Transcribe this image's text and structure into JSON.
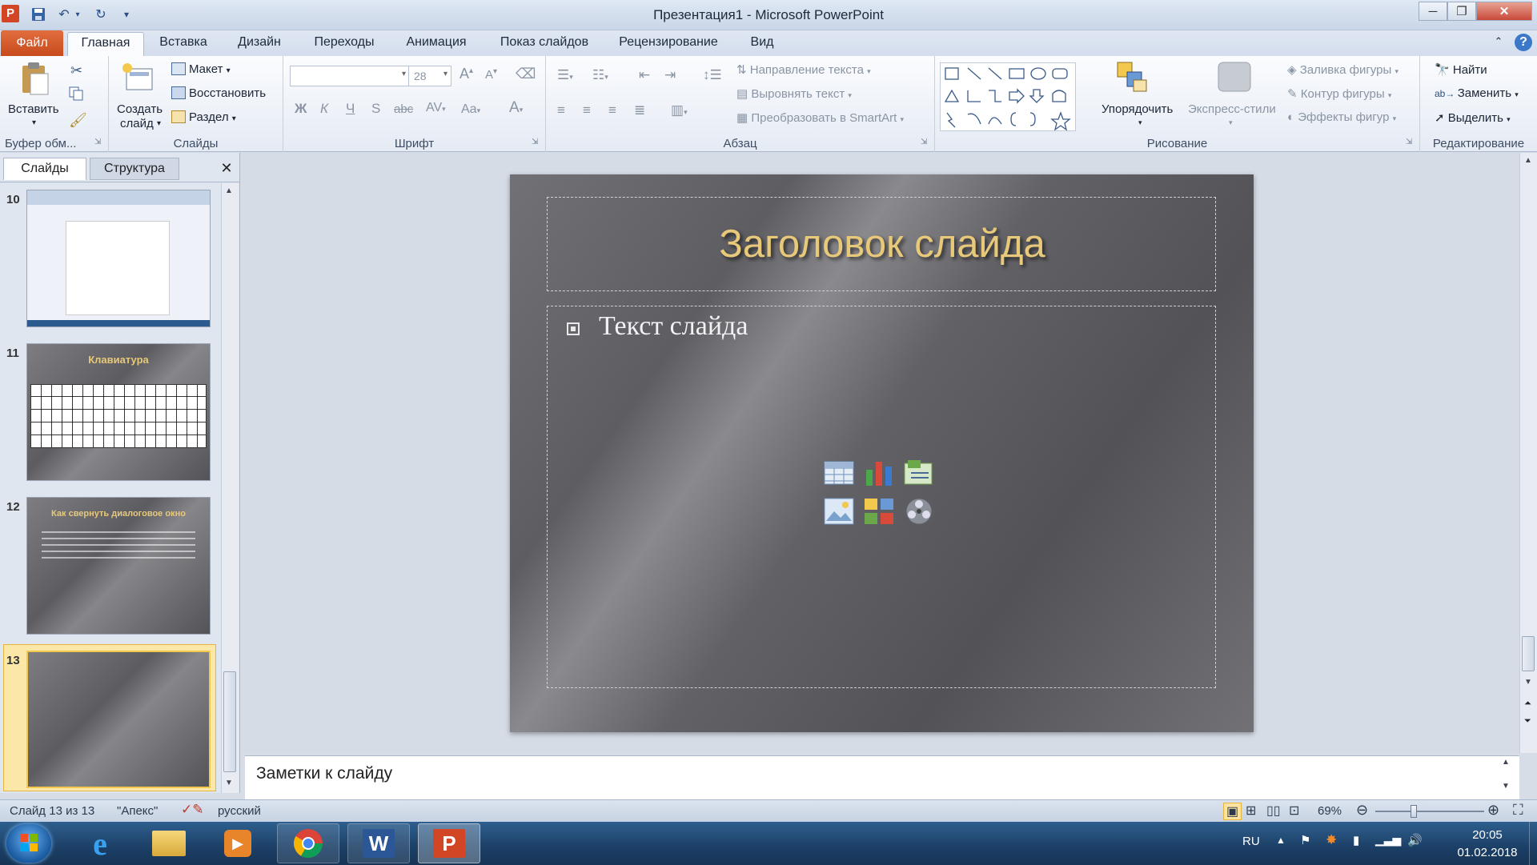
{
  "window": {
    "title": "Презентация1  -  Microsoft PowerPoint",
    "app_letter": "P"
  },
  "tabs": {
    "file": "Файл",
    "items": [
      "Главная",
      "Вставка",
      "Дизайн",
      "Переходы",
      "Анимация",
      "Показ слайдов",
      "Рецензирование",
      "Вид"
    ]
  },
  "ribbon": {
    "clipboard": {
      "label": "Буфер обм...",
      "paste": "Вставить"
    },
    "slides": {
      "label": "Слайды",
      "new_slide_1": "Создать",
      "new_slide_2": "слайд",
      "layout": "Макет",
      "reset": "Восстановить",
      "section": "Раздел"
    },
    "font": {
      "label": "Шрифт",
      "size": "28"
    },
    "paragraph": {
      "label": "Абзац",
      "text_direction": "Направление текста",
      "align_text": "Выровнять текст",
      "smartart": "Преобразовать в SmartArt"
    },
    "drawing": {
      "label": "Рисование",
      "arrange": "Упорядочить",
      "quick_styles": "Экспресс-стили",
      "shape_fill": "Заливка фигуры",
      "shape_outline": "Контур фигуры",
      "shape_effects": "Эффекты фигур"
    },
    "editing": {
      "label": "Редактирование",
      "find": "Найти",
      "replace": "Заменить",
      "select": "Выделить"
    }
  },
  "left_panel": {
    "tab_slides": "Слайды",
    "tab_outline": "Структура",
    "thumbs": [
      {
        "num": "10"
      },
      {
        "num": "11",
        "title": "Клавиатура"
      },
      {
        "num": "12",
        "title": "Как свернуть диалоговое окно"
      },
      {
        "num": "13"
      }
    ]
  },
  "slide": {
    "title": "Заголовок слайда",
    "bullet": "Текст слайда"
  },
  "notes": {
    "text": "Заметки к слайду"
  },
  "status": {
    "slide_of": "Слайд 13 из 13",
    "theme": "\"Апекс\"",
    "language": "русский",
    "zoom": "69%",
    "zoom_level": 0.35
  },
  "taskbar": {
    "lang": "RU",
    "time": "20:05",
    "date": "01.02.2018"
  },
  "colors": {
    "accent_file_tab": "#d4562a",
    "title_gold": "#e8c97a",
    "selected_thumb": "#f2c94c"
  }
}
